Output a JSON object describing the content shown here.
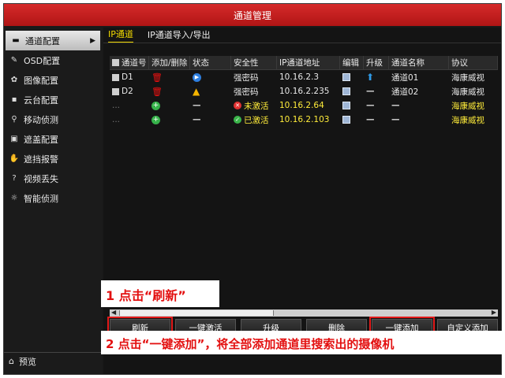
{
  "window": {
    "title": "通道管理"
  },
  "sidebar": {
    "items": [
      {
        "label": "通道配置",
        "icon": "channel-icon",
        "active": true
      },
      {
        "label": "OSD配置",
        "icon": "osd-icon"
      },
      {
        "label": "图像配置",
        "icon": "image-icon"
      },
      {
        "label": "云台配置",
        "icon": "ptz-icon"
      },
      {
        "label": "移动侦测",
        "icon": "motion-icon"
      },
      {
        "label": "遮盖配置",
        "icon": "mask-icon"
      },
      {
        "label": "遮挡报警",
        "icon": "tamper-icon"
      },
      {
        "label": "视频丢失",
        "icon": "video-loss-icon"
      },
      {
        "label": "智能侦测",
        "icon": "smart-icon"
      }
    ],
    "bottom": {
      "label": "预览",
      "icon": "home-icon"
    }
  },
  "tabs": [
    {
      "label": "IP通道",
      "active": true
    },
    {
      "label": "IP通道导入/导出"
    }
  ],
  "table": {
    "headers": [
      "通道号",
      "添加/删除",
      "状态",
      "安全性",
      "IP通道地址",
      "编辑",
      "升级",
      "通道名称",
      "协议"
    ],
    "rows": [
      {
        "channel": "D1",
        "security": "强密码",
        "ip": "10.16.2.3",
        "name": "通道01",
        "protocol": "海康威视"
      },
      {
        "channel": "D2",
        "security": "强密码",
        "ip": "10.16.2.235",
        "name": "通道02",
        "protocol": "海康威视"
      },
      {
        "channel": "...",
        "security": "未激活",
        "ip": "10.16.2.64",
        "name": "",
        "protocol": "海康威视"
      },
      {
        "channel": "...",
        "security": "已激活",
        "ip": "10.16.2.103",
        "name": "",
        "protocol": "海康威视"
      }
    ]
  },
  "buttons": {
    "refresh": "刷新",
    "activate": "一键激活",
    "upgrade": "升级",
    "delete": "删除",
    "add_all": "一键添加",
    "custom_add": "自定义添加"
  },
  "annotations": {
    "step1": "1 点击“刷新”",
    "step2": "2 点击“一键添加”，将全部添加通道里搜索出的摄像机"
  },
  "colors": {
    "accent": "#c41e1e",
    "highlight": "#ffec3a",
    "annotation": "#e31010"
  }
}
